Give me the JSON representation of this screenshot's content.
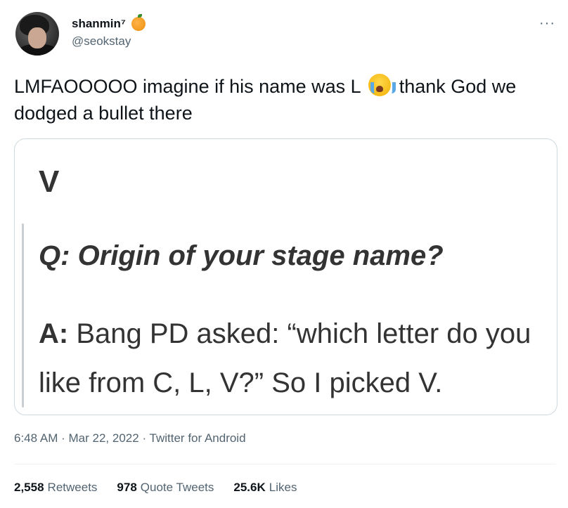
{
  "user": {
    "display_name": "shanmin⁷",
    "name_emoji": "orange-emoji",
    "handle": "@seokstay"
  },
  "tweet": {
    "text_before_emoji": "LMFAOOOOO imagine if his name was L",
    "emoji": "loudly-crying-face-emoji",
    "text_after_emoji": "thank God we dodged a bullet there"
  },
  "media": {
    "title": "V",
    "question_prefix": "Q:",
    "question": "Origin of your stage name?",
    "answer_prefix": "A:",
    "answer": "Bang PD asked: “which letter do you like from C, L, V?” So I picked V."
  },
  "meta": {
    "time": "6:48 AM",
    "date": "Mar 22, 2022",
    "source": "Twitter for Android",
    "separator": "·"
  },
  "stats": {
    "retweets_count": "2,558",
    "retweets_label": "Retweets",
    "quotes_count": "978",
    "quotes_label": "Quote Tweets",
    "likes_count": "25.6K",
    "likes_label": "Likes"
  },
  "colors": {
    "text": "#0f1419",
    "secondary": "#536471",
    "border": "#cfd9de"
  }
}
